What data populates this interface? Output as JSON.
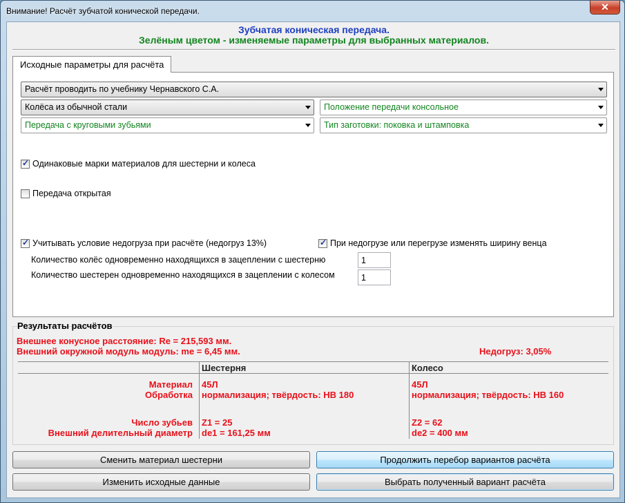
{
  "window": {
    "title": "Внимание! Расчёт зубчатой конической передачи.",
    "close_label": "✕"
  },
  "header": {
    "line1": "Зубчатая коническая передача.",
    "line2": "Зелёным цветом - изменяемые параметры для выбранных материалов.",
    "line1_color": "#1f3fbf",
    "line2_color": "#12851f"
  },
  "tab": {
    "label": "Исходные параметры для расчёта"
  },
  "params": {
    "textbook": "Расчёт проводить по учебнику Чернавского С.А.",
    "material": "Колёса из обычной стали",
    "position": "Положение передачи консольное",
    "teeth_type": "Передача с круговыми зубьями",
    "blank_type": "Тип заготовки: поковка и штамповка",
    "same_material": {
      "label": "Одинаковые марки материалов для шестерни и колеса",
      "checked": true
    },
    "open_gear": {
      "label": "Передача открытая",
      "checked": false
    },
    "underload": {
      "label": "Учитывать условие недогруза при расчёте (недогруз 13%)",
      "checked": true
    },
    "change_width": {
      "label": "При недогрузе или перегрузе изменять ширину венца",
      "checked": true
    },
    "wheels_count_label": "Количество колёс одновременно находящихся в зацеплении с шестерню",
    "wheels_count": "1",
    "pinions_count_label": "Количество шестерен одновременно находящихся в зацеплении с колесом",
    "pinions_count": "1"
  },
  "results": {
    "title": "Результаты расчётов",
    "line1": "Внешнее конусное расстояние:  Re = 215,593 мм.",
    "line2": "Внешний окружной модуль модуль:  me = 6,45 мм.",
    "underload": "Недогруз: 3,05%",
    "col_pinion": "Шестерня",
    "col_wheel": "Колесо",
    "row_material": "Материал",
    "row_treatment": "Обработка",
    "row_teeth": "Число зубьев",
    "row_diameter": "Внешний делительный диаметр",
    "pinion": {
      "material": "45Л",
      "treatment": "нормализация;  твёрдость: НВ 180",
      "teeth": "Z1 = 25",
      "diameter": "de1 = 161,25 мм"
    },
    "wheel": {
      "material": "45Л",
      "treatment": "нормализация;  твёрдость: НВ 160",
      "teeth": "Z2 = 62",
      "diameter": "de2 = 400 мм"
    },
    "accent_color": "#e8101a"
  },
  "buttons": {
    "change_pinion_material": "Сменить материал шестерни",
    "continue_search": "Продолжить перебор вариантов расчёта",
    "change_input": "Изменить исходные данные",
    "choose_variant": "Выбрать полученный вариант расчёта"
  }
}
